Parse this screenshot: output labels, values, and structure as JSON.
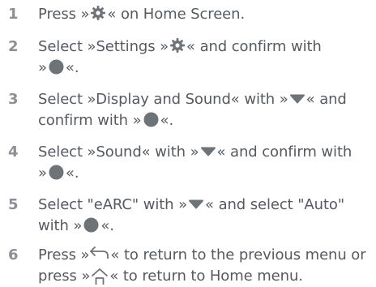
{
  "colors": {
    "text": "#555a5f",
    "number": "#8c9095",
    "icon": "#6e7378"
  },
  "icons": {
    "gear": "gear-icon",
    "ok": "ok-dot-icon",
    "down": "chevron-down-icon",
    "back": "back-arrow-icon",
    "home": "home-icon"
  },
  "steps": [
    {
      "num": "1",
      "t": [
        "Press »",
        "« on Home Screen."
      ]
    },
    {
      "num": "2",
      "t": [
        "Select »Settings »",
        "« and confirm with",
        "»",
        "«."
      ]
    },
    {
      "num": "3",
      "t": [
        "Select »Display and Sound« with »",
        "« and",
        "confirm with »",
        "«."
      ]
    },
    {
      "num": "4",
      "t": [
        "Select »Sound« with »",
        "« and confirm with",
        "»",
        "«."
      ]
    },
    {
      "num": "5",
      "t": [
        "Select \"eARC\" with »",
        "« and select \"Auto\"",
        "with »",
        "«."
      ]
    },
    {
      "num": "6",
      "t": [
        "Press »",
        "« to return to the previous menu or",
        "press »",
        "« to return to Home menu."
      ]
    }
  ]
}
